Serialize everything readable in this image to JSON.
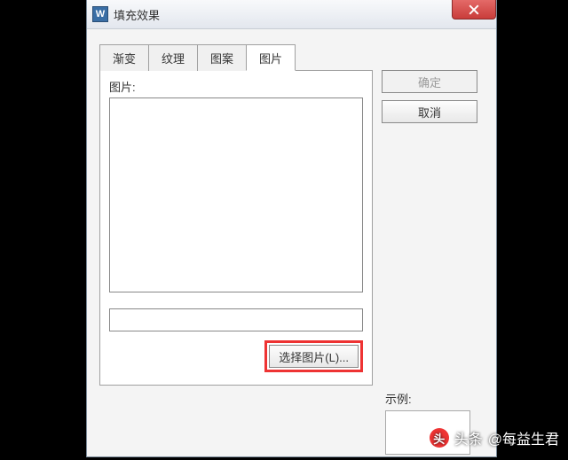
{
  "window": {
    "title": "填充效果",
    "icon_letter": "W"
  },
  "tabs": [
    {
      "label": "渐变"
    },
    {
      "label": "纹理"
    },
    {
      "label": "图案"
    },
    {
      "label": "图片"
    }
  ],
  "active_tab_index": 3,
  "panel": {
    "picture_label": "图片:",
    "name_value": "",
    "select_picture_label": "选择图片(L)..."
  },
  "buttons": {
    "ok": "确定",
    "cancel": "取消"
  },
  "example_label": "示例:",
  "watermark": {
    "prefix": "头条",
    "handle": "@每益生君"
  }
}
